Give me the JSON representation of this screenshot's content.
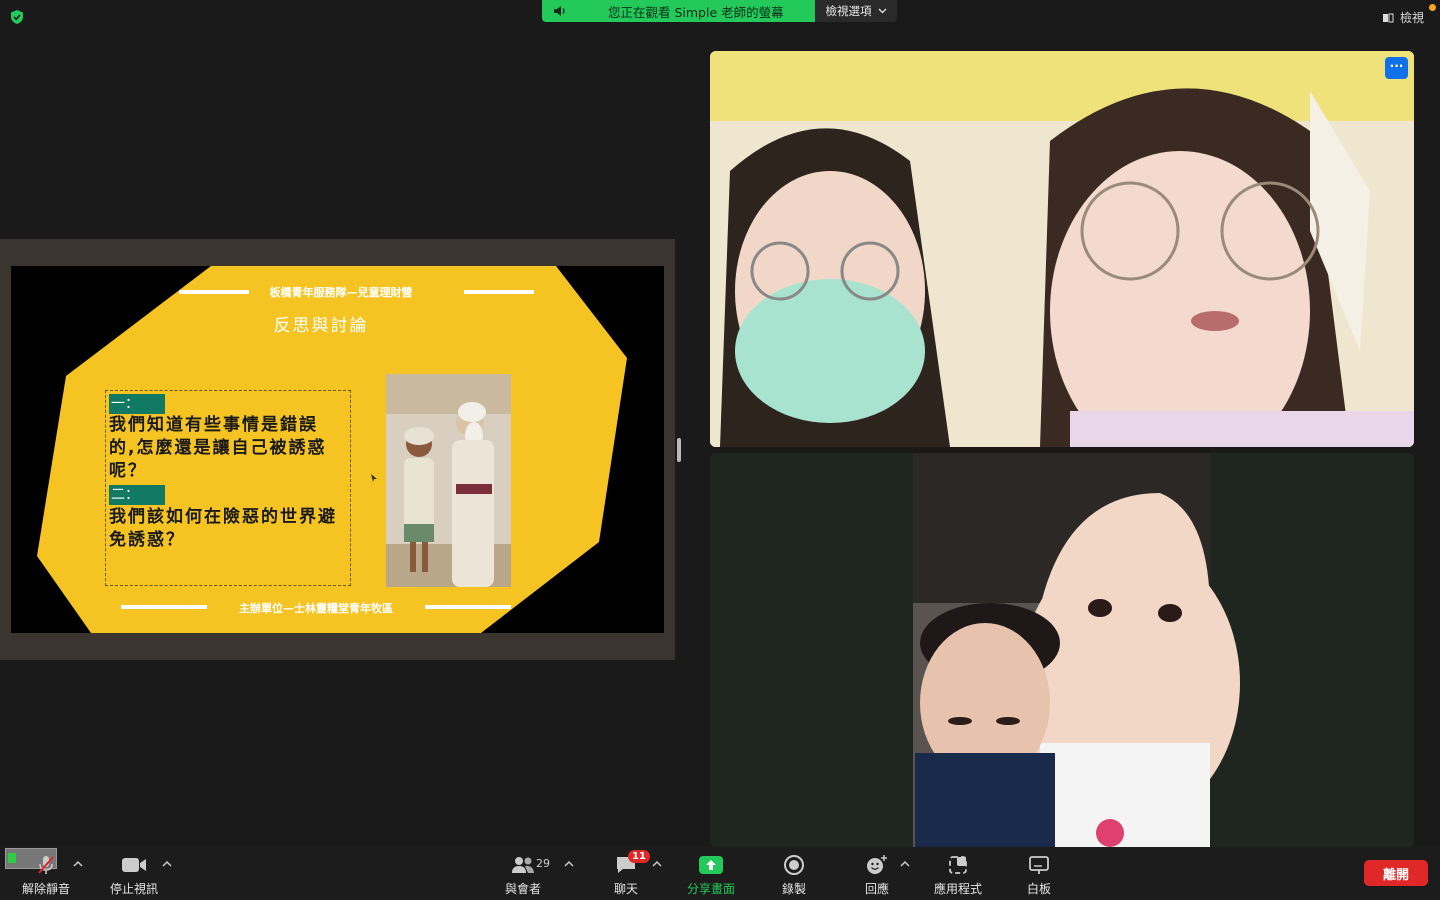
{
  "share_banner": {
    "message": "您正在觀看 Simple 老師的螢幕",
    "view_options": "檢視選項"
  },
  "top_right": {
    "view": "檢視"
  },
  "slide": {
    "header": "板橋青年服務隊—兒童理財營",
    "title": "反思與討論",
    "q1_label": "一：",
    "q1_text": "我們知道有些事情是錯誤的,怎麼還是讓自己被誘惑呢？",
    "q2_label": "二：",
    "q2_text": "我們該如何在險惡的世界避免誘惑？",
    "footer": "主辦單位—士林靈糧堂青年牧區",
    "colors": {
      "slide_yellow": "#f5c423",
      "label_green": "#127a63"
    }
  },
  "toolbar": {
    "mute_label": "解除靜音",
    "video_label": "停止視訊",
    "participants_label": "與會者",
    "participants_count": "29",
    "chat_label": "聊天",
    "chat_badge": "11",
    "share_label": "分享畫面",
    "record_label": "錄製",
    "reactions_label": "回應",
    "apps_label": "應用程式",
    "whiteboard_label": "白板",
    "leave_label": "離開"
  }
}
